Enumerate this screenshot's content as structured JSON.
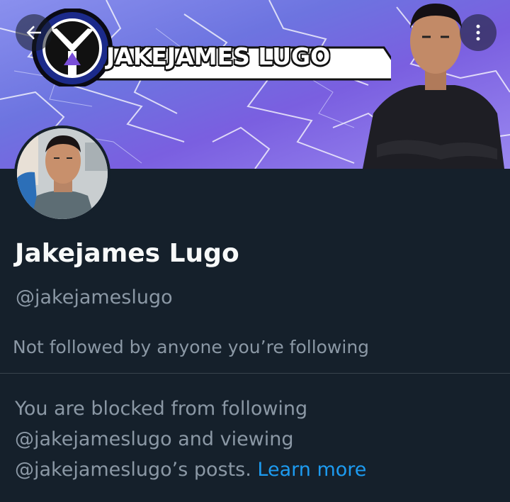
{
  "header": {
    "back_icon": "arrow-left-icon",
    "more_icon": "more-vertical-icon",
    "banner_logo_text": "JAKEJAMES LUGO"
  },
  "profile": {
    "display_name": "Jakejames Lugo",
    "handle": "@jakejameslugo",
    "followers_you_know": "Not followed by anyone you’re following"
  },
  "blocked_notice": {
    "line1": "You are blocked from following",
    "line2": "@jakejameslugo and viewing",
    "line3": "@jakejameslugo’s posts.",
    "learn_more": "Learn more"
  },
  "colors": {
    "background": "#15202b",
    "secondary_text": "#8b98a5",
    "link": "#1d9bf0"
  }
}
